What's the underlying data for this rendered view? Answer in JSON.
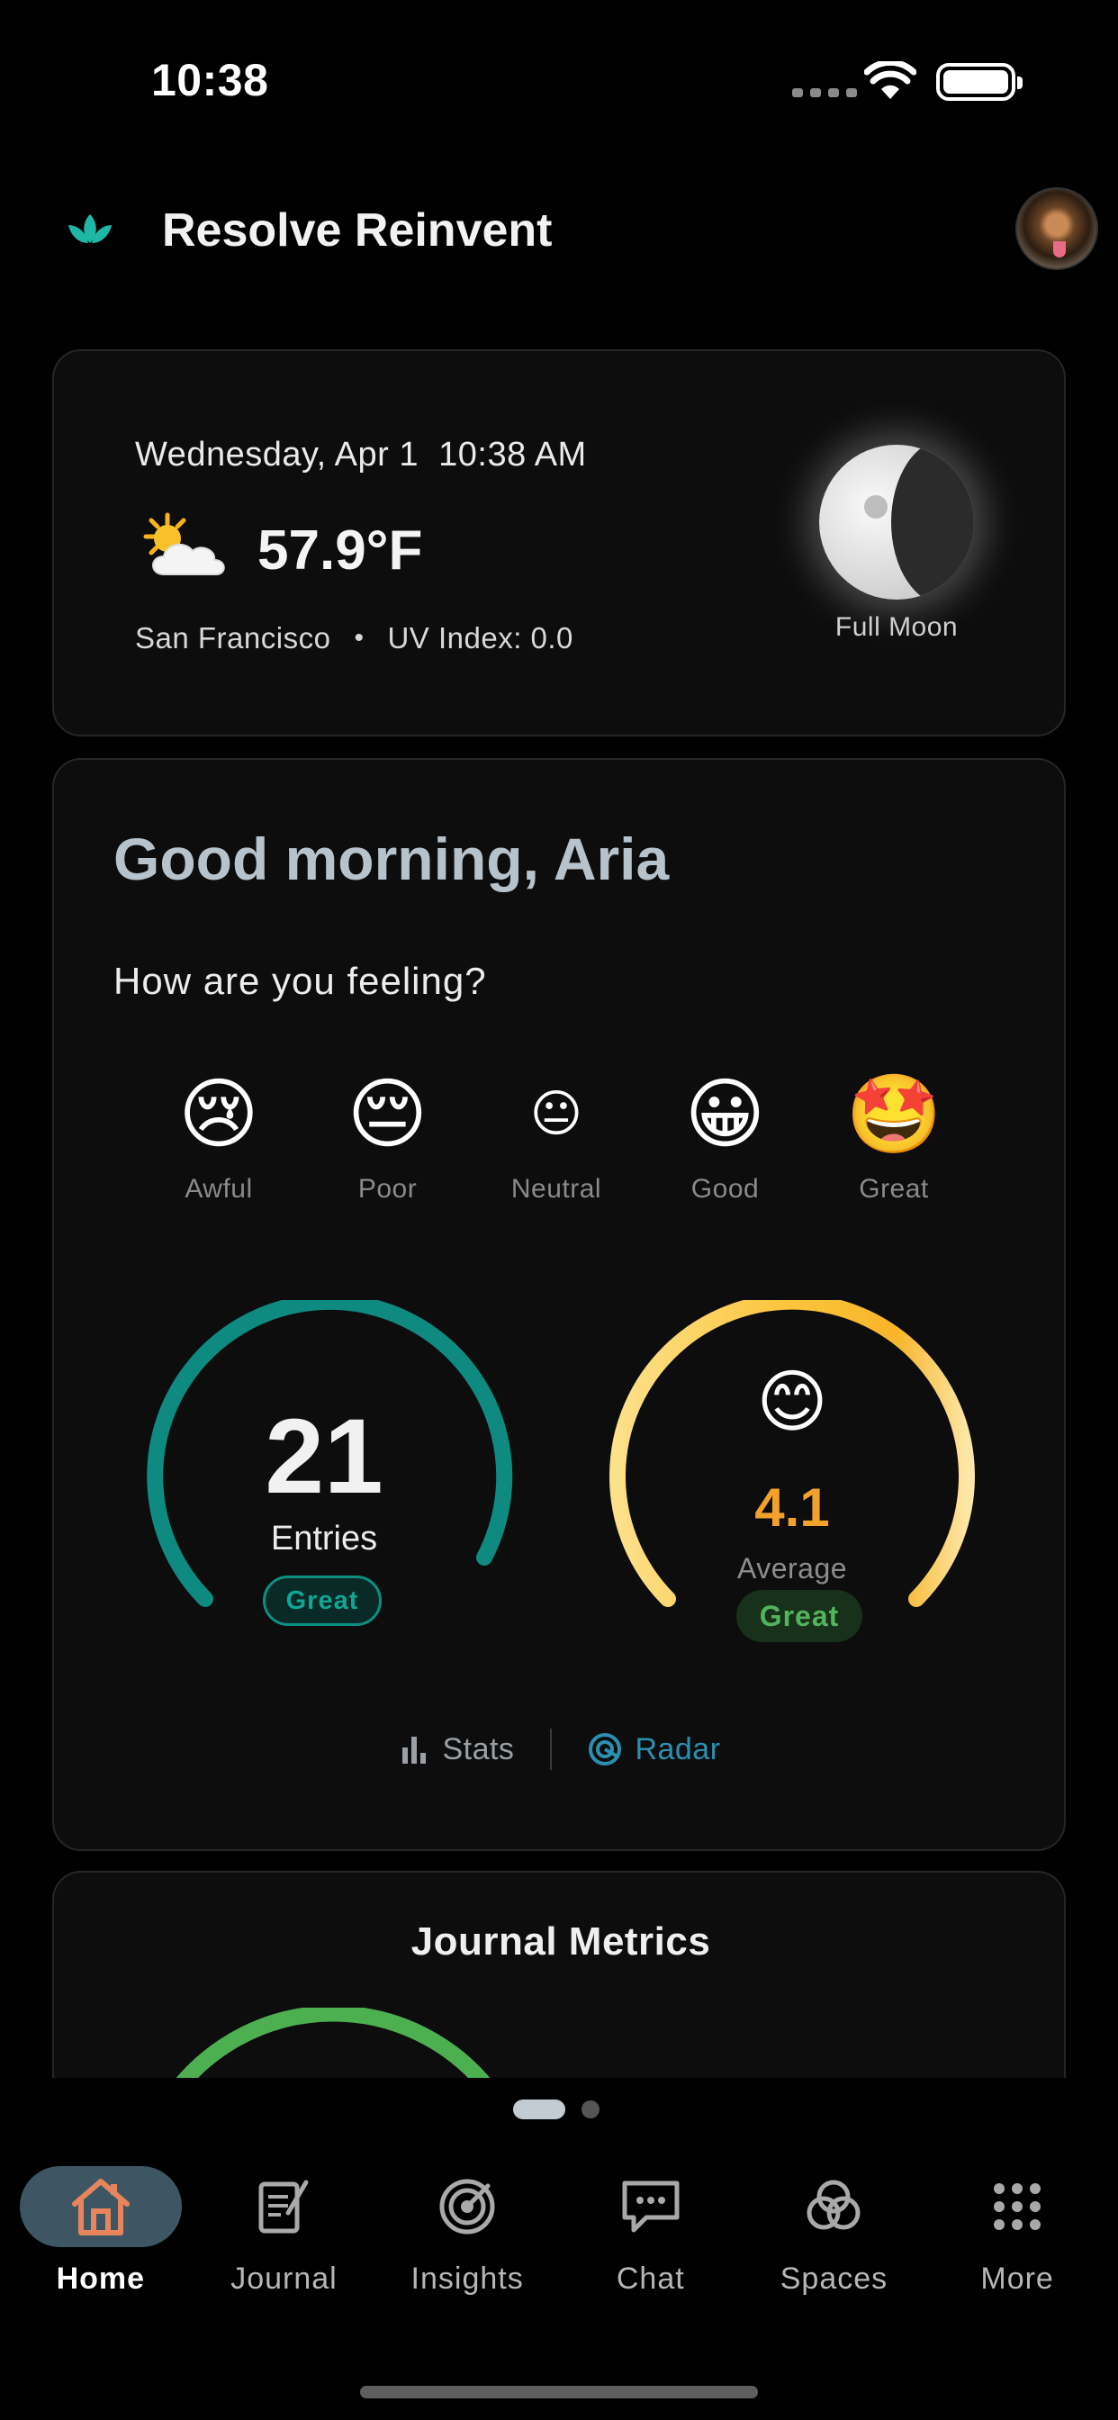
{
  "status_bar": {
    "time": "10:38"
  },
  "header": {
    "app_title": "Resolve Reinvent"
  },
  "weather": {
    "date": "Wednesday, Apr 1",
    "time": "10:38 AM",
    "temperature": "57.9°F",
    "location": "San Francisco",
    "separator": "•",
    "uv_index": "UV Index: 0.0",
    "moon_phase": "Full Moon",
    "weather_icon": "partly-sunny-icon"
  },
  "mood": {
    "greeting": "Good morning, Aria",
    "question": "How are you feeling?",
    "options": [
      {
        "emoji": "😢",
        "label": "Awful"
      },
      {
        "emoji": "😔",
        "label": "Poor"
      },
      {
        "emoji": "😐",
        "label": "Neutral"
      },
      {
        "emoji": "😀",
        "label": "Good"
      },
      {
        "emoji": "🤩",
        "label": "Great"
      }
    ]
  },
  "stats": {
    "entries": {
      "value": "21",
      "label": "Entries",
      "badge": "Great",
      "color": "#0f8a80"
    },
    "average": {
      "emoji": "😊",
      "value": "4.1",
      "label": "Average",
      "badge": "Great",
      "color": "#f7c948"
    }
  },
  "view_switch": {
    "stats_label": "Stats",
    "radar_label": "Radar",
    "active": "Radar"
  },
  "metrics": {
    "title": "Journal Metrics"
  },
  "pager": {
    "page_count": 2,
    "current_page": 1
  },
  "nav": {
    "tabs": [
      {
        "label": "Home",
        "icon": "home-icon",
        "active": true
      },
      {
        "label": "Journal",
        "icon": "journal-icon",
        "active": false
      },
      {
        "label": "Insights",
        "icon": "insights-icon",
        "active": false
      },
      {
        "label": "Chat",
        "icon": "chat-icon",
        "active": false
      },
      {
        "label": "Spaces",
        "icon": "spaces-icon",
        "active": false
      },
      {
        "label": "More",
        "icon": "more-icon",
        "active": false
      }
    ]
  },
  "colors": {
    "accent_teal": "#11a594",
    "accent_gold": "#f2a12a",
    "good_green": "#53b45b",
    "radar_blue": "#2b8fb0",
    "home_orange": "#e8855c"
  }
}
